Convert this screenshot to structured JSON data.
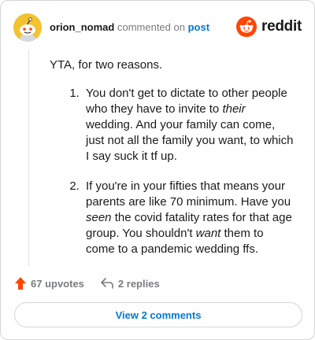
{
  "header": {
    "username": "orion_nomad",
    "action_text": "commented on",
    "post_link": "post",
    "brand": "reddit",
    "brand_color": "#ff4500"
  },
  "comment": {
    "intro": "YTA, for two reasons.",
    "points": [
      {
        "before": "You don't get to dictate to other people who they have to invite to ",
        "emphasis": "their",
        "after": " wedding. And your family can come, just not all the family you want, to which I say suck it tf up."
      },
      {
        "before": "If you're in your fifties that means your parents are like 70 minimum. Have you ",
        "emphasis": "seen",
        "middle": " the covid fatality rates for that age group. You shouldn't ",
        "emphasis2": "want",
        "after": " them to come to a pandemic wedding ffs."
      }
    ]
  },
  "footer": {
    "upvotes": "67 upvotes",
    "replies": "2 replies",
    "view_comments": "View 2 comments",
    "upvote_color": "#ff4500",
    "link_color": "#0079d3"
  },
  "icons": {
    "avatar": "snoo-avatar-icon",
    "brand": "reddit-logo-icon",
    "upvote": "upvote-arrow-icon",
    "reply": "reply-arrow-icon"
  }
}
